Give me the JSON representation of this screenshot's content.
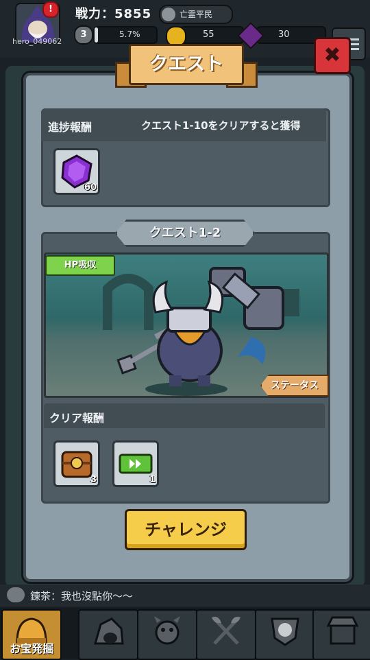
{
  "hud": {
    "hero_id": "hero_049062",
    "alert_badge": "!",
    "power_label": "戦力：5855",
    "rank_label": "亡霊平民",
    "level": "3",
    "exp_percent": "5.7%",
    "exp_fraction": 0.057,
    "gold": "55",
    "gems": "30"
  },
  "modal": {
    "title": "クエスト",
    "close_symbol": "✖",
    "progress_reward": {
      "title": "進捗報酬",
      "note": "クエスト1-10をクリアすると獲得",
      "items": [
        {
          "icon": "purple-gem-icon",
          "count": "60"
        }
      ]
    },
    "stage": {
      "name": "クエスト1-2",
      "skill_tag": "HP吸収",
      "status_button": "ステータス"
    },
    "clear_reward": {
      "title": "クリア報酬",
      "items": [
        {
          "icon": "treasure-chest-icon",
          "count": "3"
        },
        {
          "icon": "skip-ticket-icon",
          "count": "1"
        }
      ]
    },
    "challenge_button": "チャレンジ"
  },
  "chat": {
    "message": "錬茶：我也沒點你～～"
  },
  "nav": {
    "tabs": [
      {
        "label": "お宝発掘",
        "icon": "treasure-helmet-icon"
      },
      {
        "label": "",
        "icon": "rock-icon"
      },
      {
        "label": "",
        "icon": "monster-icon"
      },
      {
        "label": "",
        "icon": "crossed-axes-icon"
      },
      {
        "label": "",
        "icon": "skull-crest-icon"
      },
      {
        "label": "",
        "icon": "shop-icon"
      }
    ]
  },
  "colors": {
    "accent_gold": "#f6cc4b",
    "close_red": "#d7353a",
    "skill_green": "#7fd24b",
    "gem_purple": "#8a2fd0"
  }
}
